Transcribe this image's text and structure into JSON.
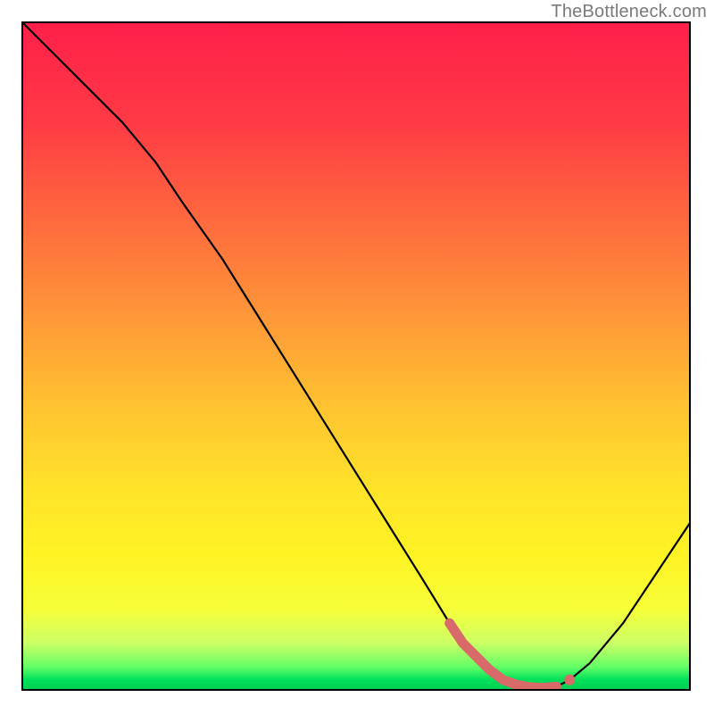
{
  "watermark": "TheBottleneck.com",
  "chart_data": {
    "type": "line",
    "title": "",
    "xlabel": "",
    "ylabel": "",
    "xlim": [
      0,
      100
    ],
    "ylim": [
      0,
      100
    ],
    "x": [
      0,
      5,
      10,
      15,
      20,
      24,
      30,
      35,
      40,
      45,
      50,
      55,
      60,
      64,
      68,
      70,
      72,
      74,
      76,
      78,
      80,
      82,
      85,
      90,
      95,
      100
    ],
    "values": [
      100,
      95,
      90,
      85,
      79,
      73,
      64.5,
      56.5,
      48.5,
      40.5,
      32.5,
      24.5,
      16.5,
      10,
      5,
      3,
      1.5,
      0.8,
      0.4,
      0.3,
      0.5,
      1.5,
      4,
      10,
      17.5,
      25
    ],
    "gradient_stops": [
      {
        "offset": 0.0,
        "color": "#ff1f4a"
      },
      {
        "offset": 0.15,
        "color": "#ff3a45"
      },
      {
        "offset": 0.3,
        "color": "#ff6a3e"
      },
      {
        "offset": 0.45,
        "color": "#ff9a38"
      },
      {
        "offset": 0.58,
        "color": "#ffc430"
      },
      {
        "offset": 0.7,
        "color": "#ffe32a"
      },
      {
        "offset": 0.8,
        "color": "#fff324"
      },
      {
        "offset": 0.88,
        "color": "#f6ff3a"
      },
      {
        "offset": 0.93,
        "color": "#ccff66"
      },
      {
        "offset": 0.965,
        "color": "#66ff66"
      },
      {
        "offset": 0.985,
        "color": "#00e05a"
      },
      {
        "offset": 1.0,
        "color": "#00d050"
      }
    ],
    "marker_color": "#d86a6a",
    "marker_points_x": [
      64,
      66,
      68,
      70,
      72,
      74,
      76,
      78,
      80
    ],
    "marker_points_y": [
      10,
      7,
      5,
      3,
      1.5,
      0.8,
      0.4,
      0.3,
      0.5
    ],
    "marker_dot": {
      "x": 82,
      "y": 1.5
    }
  }
}
